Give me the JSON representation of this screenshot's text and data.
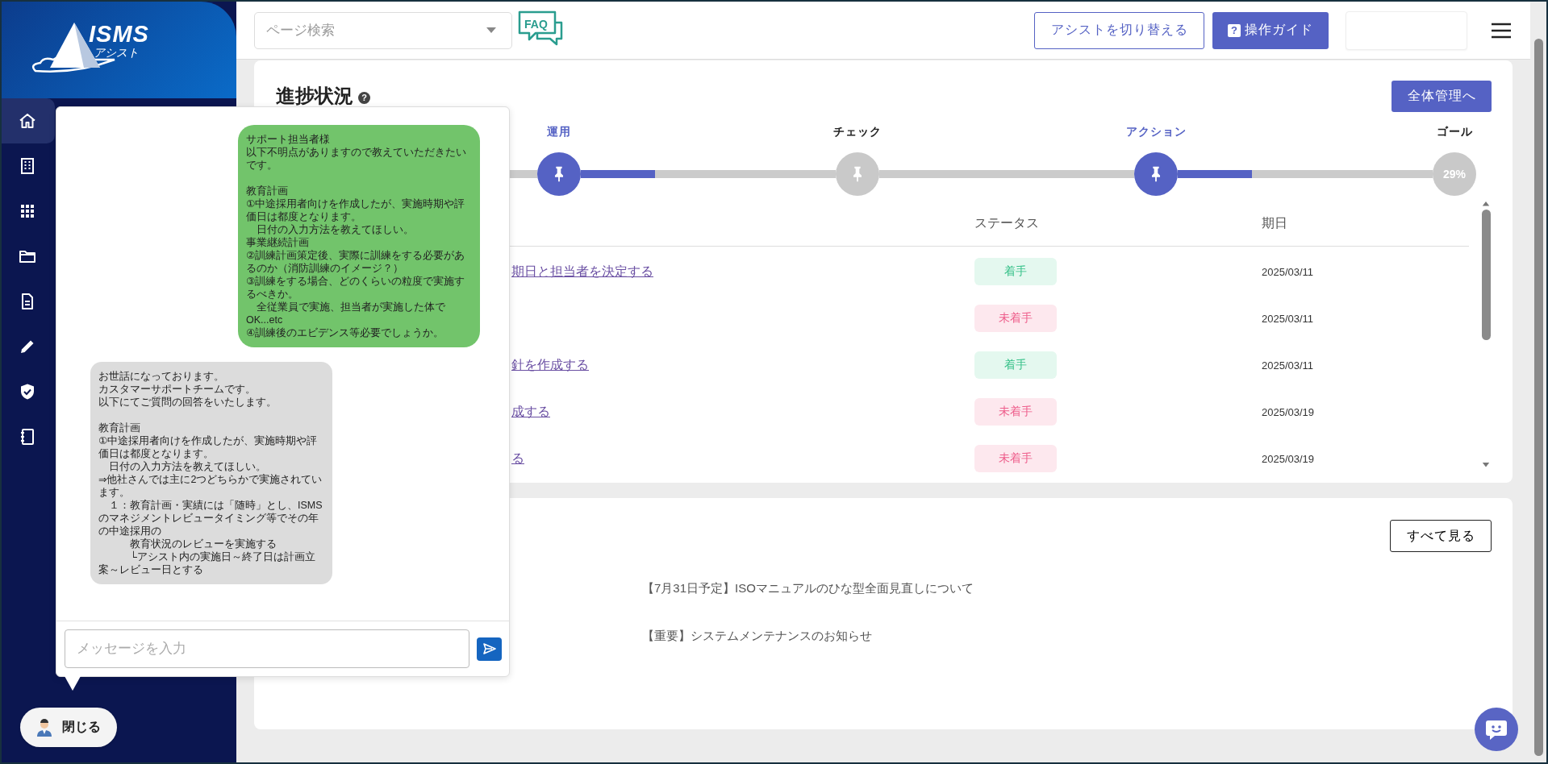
{
  "sidebar": {
    "logo": {
      "title": "ISMS",
      "subtitle": "アシスト"
    },
    "items": [
      {
        "kind": "home",
        "selected": true
      },
      {
        "kind": "building",
        "selected": false
      },
      {
        "kind": "grid",
        "selected": false
      },
      {
        "kind": "folder",
        "selected": false
      },
      {
        "kind": "document",
        "selected": false
      },
      {
        "kind": "pencil",
        "selected": false
      },
      {
        "kind": "shield",
        "selected": false
      },
      {
        "kind": "notebook",
        "selected": false
      }
    ]
  },
  "topbar": {
    "search": {
      "placeholder": "ページ検索"
    },
    "faq": "FAQ",
    "buttons": [
      {
        "label": "アシストを切り替える",
        "kind": "outline"
      },
      {
        "label": "操作ガイド",
        "kind": "guide",
        "icon": "?"
      }
    ]
  },
  "progress": {
    "title": "進捗状況",
    "help_icon": "?",
    "button": "全体管理へ",
    "stages": [
      {
        "label": "運用",
        "active": true,
        "level": 0.29
      },
      {
        "label": "チェック",
        "active": false
      },
      {
        "label": "アクション",
        "active": true,
        "level": 0.29
      }
    ],
    "goal": {
      "label": "ゴール",
      "value": "29%"
    }
  },
  "tasks": {
    "columns": [
      "ステータス",
      "期日"
    ],
    "rows": [
      {
        "title": "期日と担当者を決定する",
        "status": {
          "label": "着手",
          "kind": "started"
        },
        "due": "2025/03/11"
      },
      {
        "status": {
          "label": "未着手",
          "kind": "not_started"
        },
        "due": "2025/03/11"
      },
      {
        "title": "針を作成する",
        "status": {
          "label": "着手",
          "kind": "started"
        },
        "due": "2025/03/11"
      },
      {
        "title": "成する",
        "status": {
          "label": "未着手",
          "kind": "not_started"
        },
        "due": "2025/03/19"
      },
      {
        "title": "る",
        "status": {
          "label": "未着手",
          "kind": "not_started"
        },
        "due": "2025/03/19"
      }
    ]
  },
  "news": {
    "button": "すべて見る",
    "items": [
      "【7月31日予定】ISOマニュアルのひな型全面見直しについて",
      "【重要】システムメンテナンスのお知らせ"
    ]
  },
  "chat": {
    "messages": [
      {
        "kind": "sent",
        "paragraphs": [
          [
            "サポート担当者様",
            "以下不明点がありますので教えていただきたいです。"
          ],
          [
            "教育計画",
            "①中途採用者向けを作成したが、実施時期や評価日は都度となります。",
            "　日付の入力方法を教えてほしい。",
            "事業継続計画",
            "②訓練計画策定後、実際に訓練をする必要があるのか（消防訓練のイメージ？）",
            "③訓練をする場合、どのくらいの粒度で実施するべきか。",
            "　全従業員で実施、担当者が実施した体で",
            "OK...etc",
            "④訓練後のエビデンス等必要でしょうか。"
          ]
        ]
      },
      {
        "kind": "received",
        "paragraphs": [
          [
            "お世話になっております。",
            "カスタマーサポートチームです。",
            "以下にてご質問の回答をいたします。"
          ],
          [
            "教育計画",
            "①中途採用者向けを作成したが、実施時期や評価日は都度となります。",
            "　日付の入力方法を教えてほしい。",
            "⇒他社さんでは主に2つどちらかで実施されています。",
            "　１：教育計画・実績には「随時」とし、ISMSのマネジメントレビュータイミング等でその年の中途採用の",
            "　　　教育状況のレビューを実施する",
            "　　　└アシスト内の実施日～終了日は計画立案～レビュー日とする"
          ]
        ]
      }
    ],
    "input": {
      "placeholder": "メッセージを入力"
    },
    "close_button": "閉じる"
  }
}
